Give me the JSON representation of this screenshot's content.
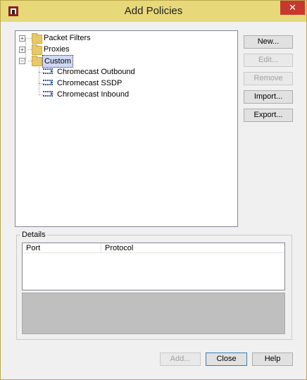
{
  "window": {
    "title": "Add Policies",
    "close_glyph": "✕"
  },
  "tree": {
    "nodes": [
      {
        "label": "Packet Filters",
        "expander": "+",
        "icon": "folder-icon"
      },
      {
        "label": "Proxies",
        "expander": "+",
        "icon": "folder-icon"
      },
      {
        "label": "Custom",
        "expander": "−",
        "icon": "folder-icon",
        "selected": true
      }
    ],
    "children": [
      {
        "label": "Chromecast Outbound",
        "icon": "policy-icon"
      },
      {
        "label": "Chromecast SSDP",
        "icon": "policy-icon"
      },
      {
        "label": "Chromecast Inbound",
        "icon": "policy-icon"
      }
    ]
  },
  "side_buttons": {
    "new": "New...",
    "edit": "Edit...",
    "remove": "Remove",
    "import": "Import...",
    "export": "Export..."
  },
  "details": {
    "legend": "Details",
    "columns": [
      "Port",
      "Protocol"
    ]
  },
  "footer": {
    "add": "Add...",
    "close": "Close",
    "help": "Help"
  },
  "colors": {
    "titlebar": "#e7d879",
    "close_button": "#c7382f",
    "selection": "#cfd8f7",
    "folder": "#e8c867",
    "policy_icon": "#2a4f8f"
  }
}
